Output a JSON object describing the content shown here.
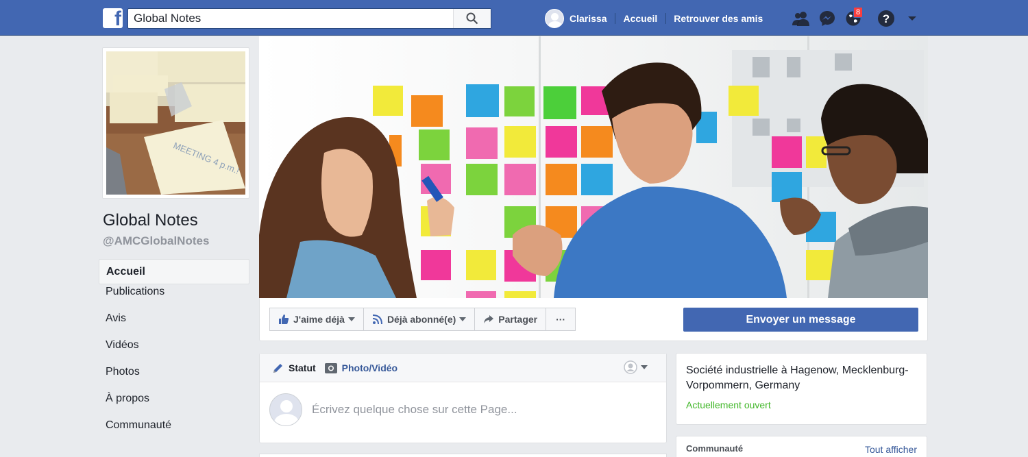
{
  "topbar": {
    "logo_letter": "f",
    "search_value": "Global Notes",
    "user_name": "Clarissa",
    "links": [
      "Accueil",
      "Retrouver des amis"
    ],
    "notification_count": "8",
    "accent": "#4267b2"
  },
  "page": {
    "name": "Global Notes",
    "handle": "@AMCGlobalNotes",
    "profile_note_text": "MEETING 4 p.m.!"
  },
  "sidebar": {
    "items": [
      {
        "label": "Accueil"
      },
      {
        "label": "Publications"
      },
      {
        "label": "Avis"
      },
      {
        "label": "Vidéos"
      },
      {
        "label": "Photos"
      },
      {
        "label": "À propos"
      },
      {
        "label": "Communauté"
      }
    ]
  },
  "actions": {
    "like": "J'aime déjà",
    "follow": "Déjà abonné(e)",
    "share": "Partager",
    "more": "···",
    "message": "Envoyer un message"
  },
  "composer": {
    "tab_status": "Statut",
    "tab_photo": "Photo/Vidéo",
    "placeholder": "Écrivez quelque chose sur cette Page..."
  },
  "info": {
    "description": "Société industrielle à Hagenow, Mecklenburg-Vorpommern, Germany",
    "open_status": "Actuellement ouvert",
    "open_color": "#42b72a"
  },
  "community": {
    "title": "Communauté",
    "see_all": "Tout afficher"
  }
}
